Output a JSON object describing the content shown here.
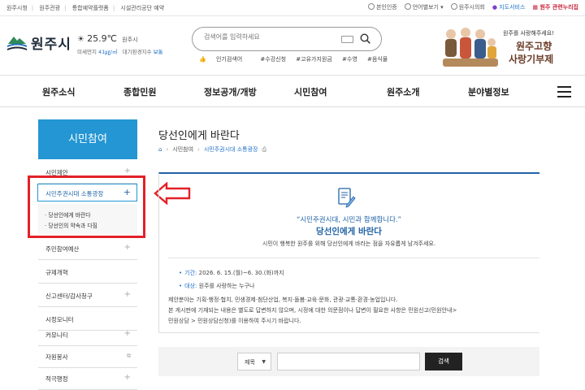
{
  "util_bar": {
    "left_links": [
      "원주시청",
      "원주관광",
      "통합예약플랫폼",
      "시설관리공단 예약"
    ],
    "right_links": {
      "verify": "본인인증",
      "language": "언어별보기",
      "council": "원주시의회",
      "map": "지도서비스",
      "related": "원주 관련누리집"
    }
  },
  "header": {
    "logo_text": "원주시",
    "weather": {
      "temp": "25.9℃",
      "city": "원주시"
    },
    "air": {
      "dust_label": "미세먼지",
      "dust_value": "41㎍/㎥",
      "env_label": "대기환경지수",
      "env_value": "보통"
    },
    "search": {
      "placeholder": "검색어를 입력하세요"
    },
    "popular": {
      "label": "인기검색어",
      "tags": [
        "#수강신청",
        "#고유가지원금",
        "#수영",
        "#음식물"
      ]
    },
    "promo": {
      "line1": "원주를 사랑해주세요!",
      "line2": "원주고향",
      "line3": "사랑기부제"
    }
  },
  "gnb": {
    "items": [
      "원주소식",
      "종합민원",
      "정보공개/개방",
      "시민참여",
      "원주소개",
      "분야별정보"
    ]
  },
  "lnb": {
    "title": "시민참여",
    "items": [
      {
        "label": "시민제안",
        "mark": "+"
      },
      {
        "label": "시민주권시대 소통광장",
        "mark": "+"
      },
      {
        "label": "주민참여예산",
        "mark": "+"
      },
      {
        "label": "규제개혁",
        "mark": ""
      },
      {
        "label": "신고센터/감사청구",
        "mark": "+"
      },
      {
        "label": "시정모니터",
        "mark": ""
      },
      {
        "label": "커뮤니티",
        "mark": "+"
      },
      {
        "label": "자원봉사",
        "mark": ""
      },
      {
        "label": "적극행정",
        "mark": "+"
      }
    ],
    "sub_items": [
      "당선인에게 바란다",
      "당선인의 약속과 다짐"
    ]
  },
  "content": {
    "title": "당선인에게 바란다",
    "breadcrumb": [
      "시민참여",
      "시민주권시대 소통광장"
    ],
    "quote": "“시민주권시대, 시민과 함께합니다.”",
    "headline": "당선인에게 바란다",
    "desc": "시민이 행복한 원주를 위해 당선인에게 바라는 점을 자유롭게 남겨주세요.",
    "period_label": "기간:",
    "period_value": "2026. 6. 15.(월)~6. 30.(화)까지",
    "target_label": "대상:",
    "target_value": "원주를 사랑하는 누구나",
    "para1": "제안분야는 기획·행정·협치, 민생경제·첨단산업, 복지·돌봄·교육·문화, 관광·교통·환경·농업입니다.",
    "para2": "본 게시판에 기재되는 내용은 별도로 답변하지 않으며, 시정에 대한 의문점이나 답변이 필요한 사항은 민원신고(민원안내>",
    "para3": "민원상담 > 민원상담신청)를 이용하여 주시기 바랍니다."
  },
  "board_search": {
    "select_value": "제목",
    "button_label": "검색"
  },
  "colors": {
    "accent_blue": "#2396d3",
    "annotation_red": "#e32128"
  }
}
